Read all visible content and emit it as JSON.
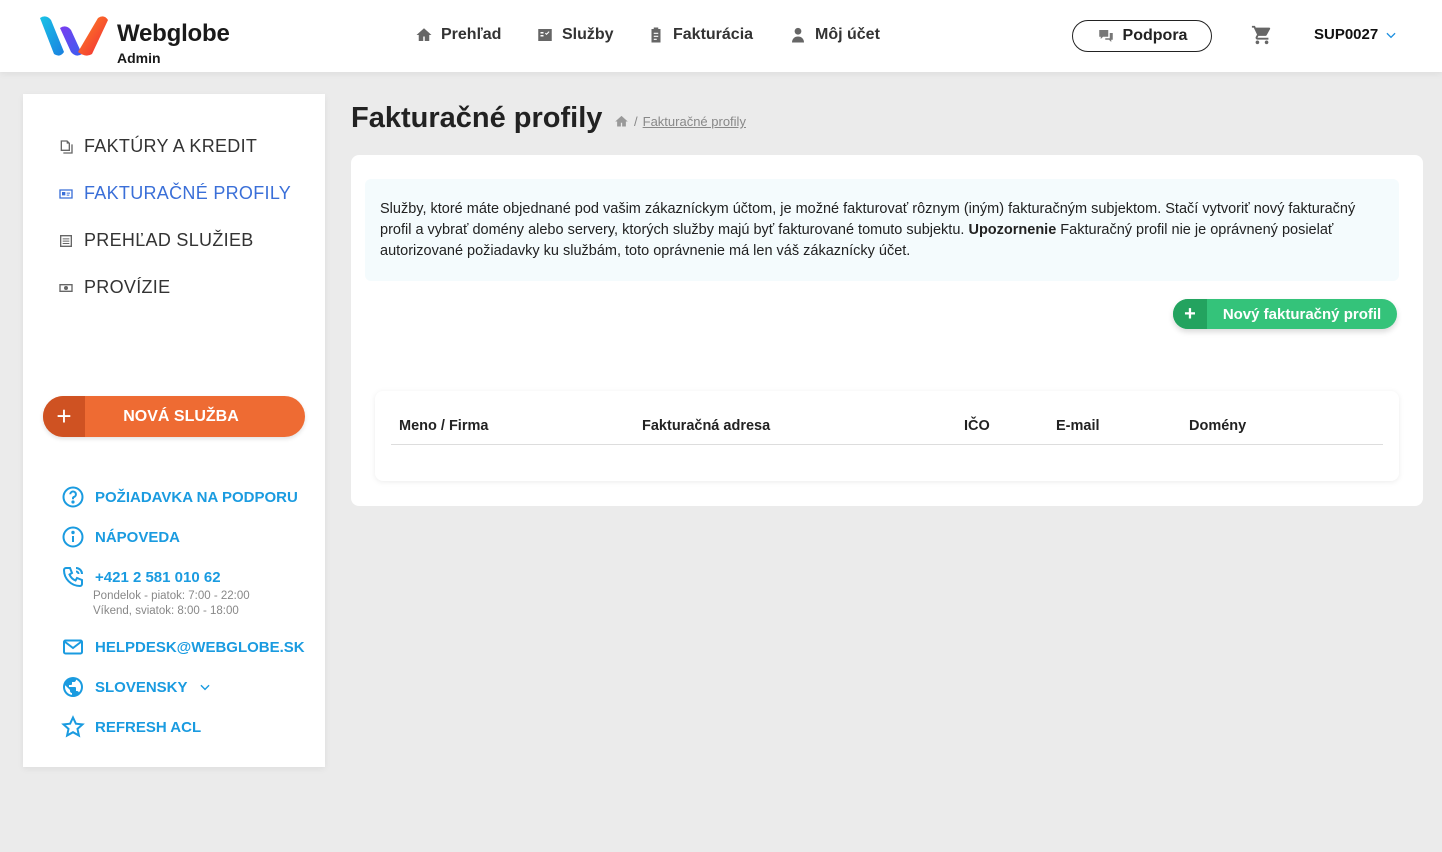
{
  "brand": {
    "name": "Webglobe",
    "sub": "Admin"
  },
  "topnav": [
    {
      "label": "Prehľad",
      "icon": "home-icon"
    },
    {
      "label": "Služby",
      "icon": "services-icon"
    },
    {
      "label": "Fakturácia",
      "icon": "clipboard-icon"
    },
    {
      "label": "Môj účet",
      "icon": "user-icon"
    }
  ],
  "header": {
    "support_label": "Podpora",
    "account_label": "SUP0027"
  },
  "sidebar": {
    "items": [
      {
        "label": "FAKTÚRY A KREDIT",
        "icon": "documents-icon",
        "active": false
      },
      {
        "label": "FAKTURAČNÉ PROFILY",
        "icon": "id-card-icon",
        "active": true
      },
      {
        "label": "PREHĽAD SLUŽIEB",
        "icon": "list-icon",
        "active": false
      },
      {
        "label": "PROVÍZIE",
        "icon": "money-icon",
        "active": false
      }
    ],
    "new_service_label": "NOVÁ SLUŽBA",
    "links": {
      "support_request": "POŽIADAVKA NA PODPORU",
      "help": "NÁPOVEDA",
      "phone": "+421 2 581 010 62",
      "hours_weekday": "Pondelok - piatok: 7:00 - 22:00",
      "hours_weekend": "Víkend, sviatok: 8:00 - 18:00",
      "email": "HELPDESK@WEBGLOBE.SK",
      "language": "SLOVENSKY",
      "refresh": "REFRESH ACL"
    }
  },
  "main": {
    "title": "Fakturačné profily",
    "breadcrumb_current": "Fakturačné profily",
    "info_text_1": "Služby, ktoré máte objednané pod vašim zákazníckym účtom, je možné fakturovať rôznym (iným) fakturačným subjektom. Stačí vytvoriť nový fakturačný profil a vybrať domény alebo servery, ktorých služby majú byť fakturované tomuto subjektu. ",
    "info_bold": "Upozornenie",
    "info_text_2": " Fakturačný profil nie je oprávnený posielať autorizované požiadavky ku službám, toto oprávnenie má len váš zákaznícky účet.",
    "new_profile_label": "Nový fakturačný profil",
    "table_headers": [
      "Meno / Firma",
      "Fakturačná adresa",
      "IČO",
      "E-mail",
      "Domény"
    ]
  },
  "colors": {
    "accent_blue": "#1a9be0",
    "active_nav": "#3a6fd8",
    "orange": "#ee6b33",
    "green": "#34c37a"
  }
}
